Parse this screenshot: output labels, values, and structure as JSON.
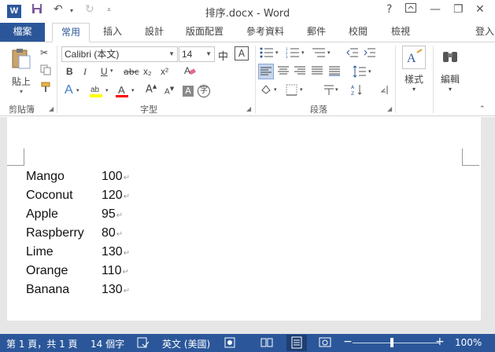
{
  "titlebar": {
    "title": "排序.docx - Word",
    "logo": "W",
    "help": "?",
    "minimize": "—",
    "restore": "❐",
    "close": "✕"
  },
  "tabs": {
    "file": "檔案",
    "items": [
      "常用",
      "插入",
      "設計",
      "版面配置",
      "參考資料",
      "郵件",
      "校閱",
      "檢視"
    ],
    "signin": "登入"
  },
  "ribbon": {
    "clipboard": {
      "paste_label": "貼上",
      "group_label": "剪貼簿"
    },
    "font": {
      "font_name": "Calibri (本文)",
      "font_size": "14",
      "group_label": "字型",
      "bold": "B",
      "italic": "I",
      "underline": "U",
      "strike": "abc",
      "subscript": "x₂",
      "superscript": "x²",
      "text_effects": "A",
      "grow": "A",
      "shrink": "A",
      "char_shade": "A",
      "enclose": "字",
      "phonetic": "中",
      "border_char": "A"
    },
    "paragraph": {
      "group_label": "段落"
    },
    "styles": {
      "label": "樣式"
    },
    "editing": {
      "label": "編輯"
    }
  },
  "document": {
    "rows": [
      {
        "name": "Mango",
        "value": "100"
      },
      {
        "name": "Coconut",
        "value": "120"
      },
      {
        "name": "Apple",
        "value": "95"
      },
      {
        "name": "Raspberry",
        "value": "80"
      },
      {
        "name": "Lime",
        "value": "130"
      },
      {
        "name": "Orange",
        "value": "110"
      },
      {
        "name": "Banana",
        "value": "130"
      }
    ],
    "paragraph_mark": "↵"
  },
  "status": {
    "page": "第 1 頁，共 1 頁",
    "words": "14 個字",
    "language": "英文 (美國)",
    "zoom": "100%",
    "zoom_minus": "−",
    "zoom_plus": "+"
  },
  "colors": {
    "accent": "#2b579a",
    "highlight": "#ffff00",
    "font_color": "#ff0000"
  }
}
